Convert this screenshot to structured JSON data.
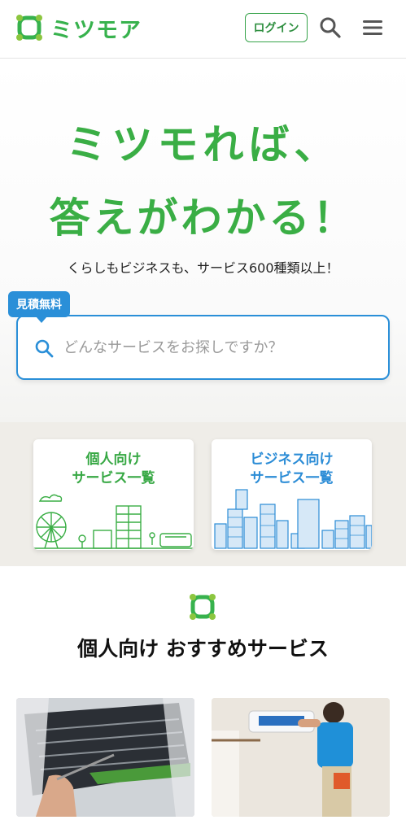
{
  "header": {
    "logo_text": "ミツモア",
    "login_label": "ログイン",
    "search_icon": "search-icon",
    "menu_icon": "hamburger-menu-icon"
  },
  "hero": {
    "headline_1": "ミツモれば、",
    "headline_2": "答えがわかる！",
    "subtitle": "くらしもビジネスも、サービス600種類以上！"
  },
  "search": {
    "tag": "見積無料",
    "placeholder": "どんなサービスをお探しですか？"
  },
  "categories": [
    {
      "line1": "個人向け",
      "line2": "サービス一覧"
    },
    {
      "line1": "ビジネス向け",
      "line2": "サービス一覧"
    }
  ],
  "recommended": {
    "title": "個人向け おすすめサービス"
  },
  "colors": {
    "brand_green": "#3aae45",
    "brand_blue": "#2a8fd8"
  }
}
